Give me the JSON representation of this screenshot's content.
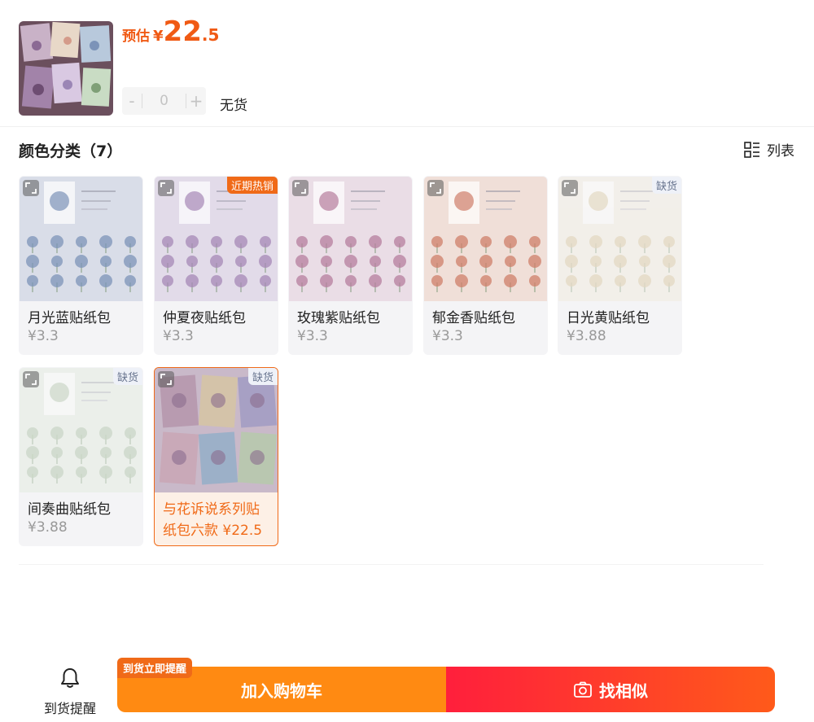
{
  "product": {
    "price_label": "预估",
    "price_symbol": "¥",
    "price_int": "22",
    "price_dec": ".5",
    "quantity": "0",
    "minus_label": "-",
    "plus_label": "+",
    "stock_status": "无货"
  },
  "section": {
    "title": "颜色分类（7）",
    "view_label": "列表"
  },
  "skus": [
    {
      "name": "月光蓝贴纸包",
      "price": "¥3.3",
      "badge": "",
      "tint": "#d9dde8",
      "accent": "#7c93b8"
    },
    {
      "name": "仲夏夜贴纸包",
      "price": "¥3.3",
      "badge": "近期热销",
      "tint": "#e2dbe9",
      "accent": "#a688b6"
    },
    {
      "name": "玫瑰紫贴纸包",
      "price": "¥3.3",
      "badge": "",
      "tint": "#eadde6",
      "accent": "#b67e9d"
    },
    {
      "name": "郁金香贴纸包",
      "price": "¥3.3",
      "badge": "",
      "tint": "#f0dfd8",
      "accent": "#cf7f6a"
    },
    {
      "name": "日光黄贴纸包",
      "price": "¥3.88",
      "badge": "缺货",
      "tint": "#f1ebe0",
      "accent": "#d6c39a"
    },
    {
      "name": "间奏曲贴纸包",
      "price": "¥3.88",
      "badge": "缺货",
      "tint": "#e4ebe1",
      "accent": "#a9bfa2"
    },
    {
      "name_line1": "与花诉说系列贴",
      "name_line2": "纸包六款 ¥22.5",
      "badge": "缺货",
      "tint": "#c9b9c9",
      "accent": "#8a6d8e"
    }
  ],
  "bottom": {
    "notify_label": "到货提醒",
    "remind_tag": "到货立即提醒",
    "cart_label": "加入购物车",
    "similar_label": "找相似"
  },
  "colors": {
    "accent_orange": "#f06a18",
    "cart_orange": "#ff8a12",
    "similar_red": "#ff1f3c"
  }
}
